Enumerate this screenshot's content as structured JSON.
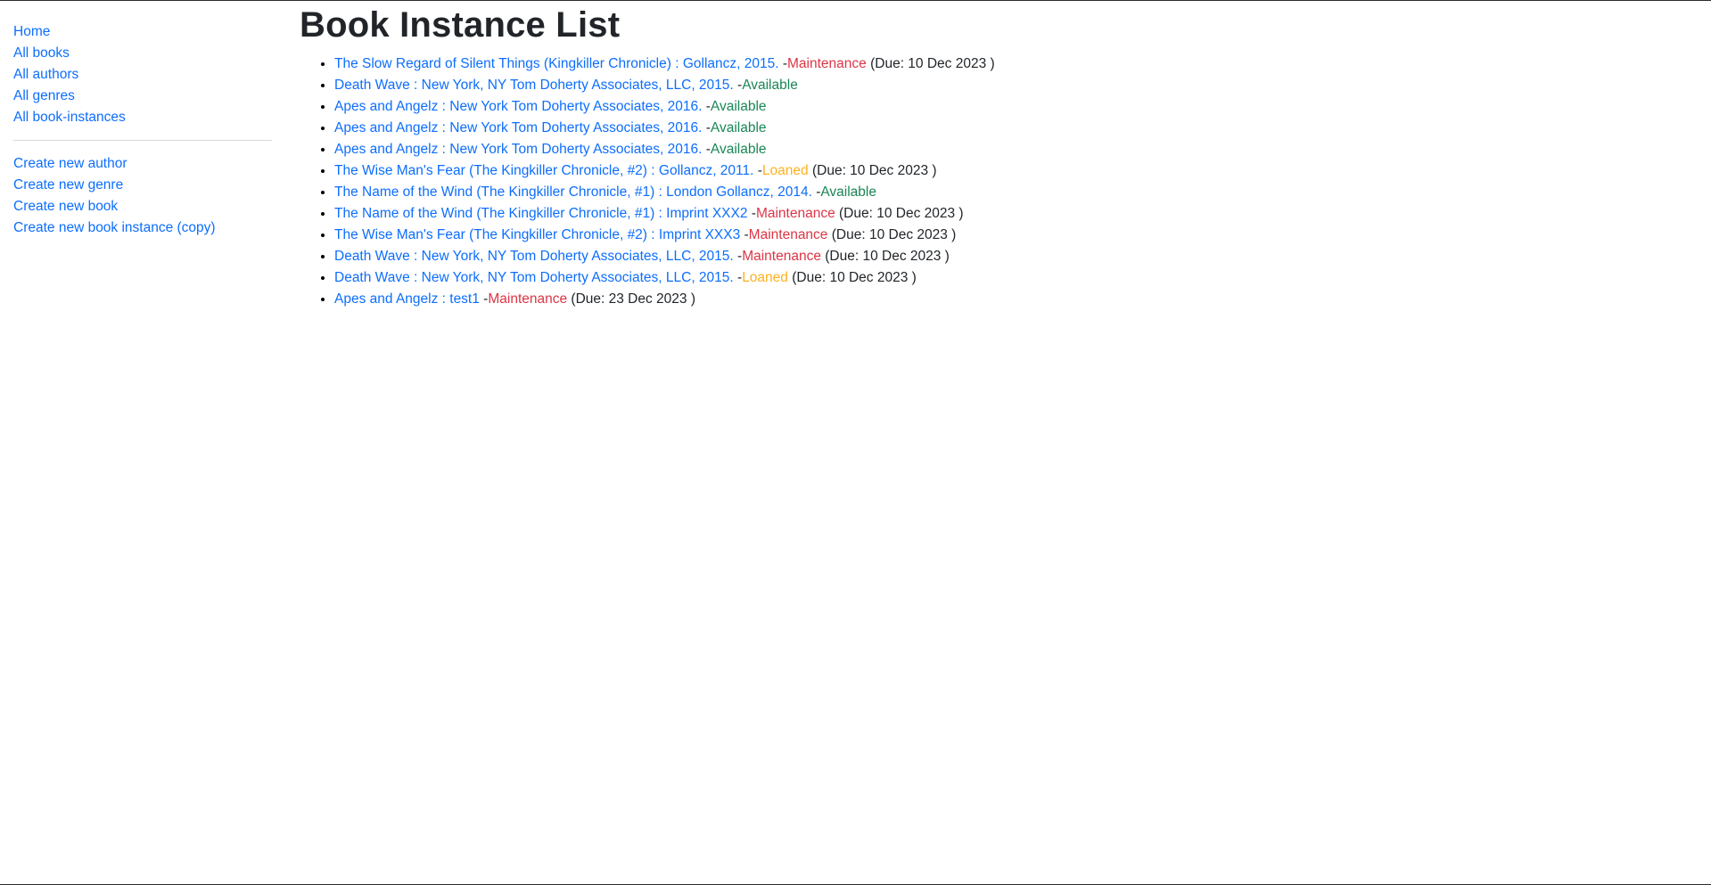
{
  "nav": {
    "primary": [
      {
        "label": "Home"
      },
      {
        "label": "All books"
      },
      {
        "label": "All authors"
      },
      {
        "label": "All genres"
      },
      {
        "label": "All book-instances"
      }
    ],
    "secondary": [
      {
        "label": "Create new author"
      },
      {
        "label": "Create new genre"
      },
      {
        "label": "Create new book"
      },
      {
        "label": "Create new book instance (copy)"
      }
    ]
  },
  "page": {
    "title": "Book Instance List"
  },
  "status_colors": {
    "Available": "#198754",
    "Maintenance": "#dc3545",
    "Loaned": "#ffb01f"
  },
  "instances": [
    {
      "title": "The Slow Regard of Silent Things (Kingkiller Chronicle) : Gollancz, 2015.",
      "status_text": "Maintenance",
      "status": "Maintenance",
      "due": "(Due: 10 Dec 2023 )"
    },
    {
      "title": "Death Wave : New York, NY Tom Doherty Associates, LLC, 2015.",
      "status_text": "Available",
      "status": "Available",
      "due": ""
    },
    {
      "title": "Apes and Angelz : New York Tom Doherty Associates, 2016.",
      "status_text": "Available",
      "status": "Available",
      "due": ""
    },
    {
      "title": "Apes and Angelz : New York Tom Doherty Associates, 2016.",
      "status_text": "Available",
      "status": "Available",
      "due": ""
    },
    {
      "title": "Apes and Angelz : New York Tom Doherty Associates, 2016.",
      "status_text": "Available",
      "status": "Available",
      "due": ""
    },
    {
      "title": "The Wise Man's Fear (The Kingkiller Chronicle, #2) : Gollancz, 2011.",
      "status_text": "Loaned",
      "status": "Loaned",
      "due": "(Due: 10 Dec 2023 )"
    },
    {
      "title": "The Name of the Wind (The Kingkiller Chronicle, #1) : London Gollancz, 2014.",
      "status_text": "Available",
      "status": "Available",
      "due": ""
    },
    {
      "title": "The Name of the Wind (The Kingkiller Chronicle, #1) : Imprint XXX2",
      "status_text": "Maintenance",
      "status": "Maintenance",
      "due": "(Due: 10 Dec 2023 )"
    },
    {
      "title": "The Wise Man's Fear (The Kingkiller Chronicle, #2) : Imprint XXX3",
      "status_text": "Maintenance",
      "status": "Maintenance",
      "due": "(Due: 10 Dec 2023 )"
    },
    {
      "title": "Death Wave : New York, NY Tom Doherty Associates, LLC, 2015.",
      "status_text": "Maintenance",
      "status": "Maintenance",
      "due": "(Due: 10 Dec 2023 )"
    },
    {
      "title": "Death Wave : New York, NY Tom Doherty Associates, LLC, 2015.",
      "status_text": "Loaned",
      "status": "Loaned",
      "due": "(Due: 10 Dec 2023 )"
    },
    {
      "title": "Apes and Angelz : test1",
      "status_text": "Maintenance",
      "status": "Maintenance",
      "due": "(Due: 23 Dec 2023 )"
    }
  ]
}
